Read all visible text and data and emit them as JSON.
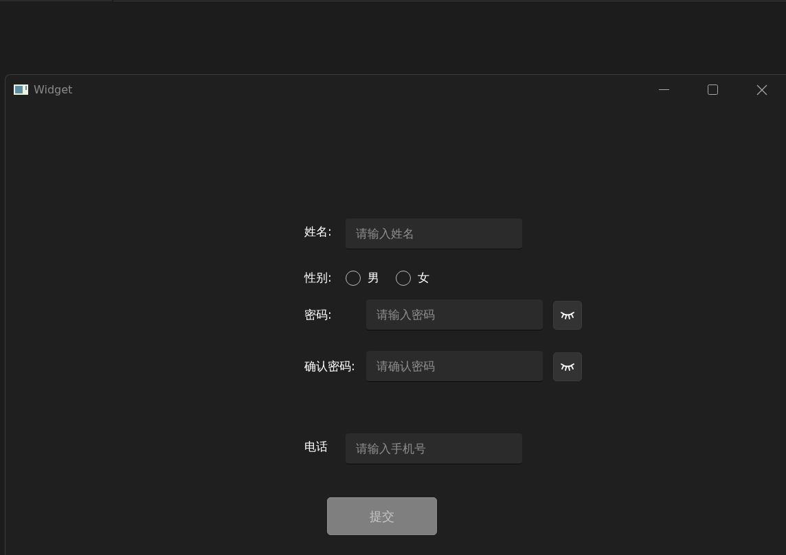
{
  "window": {
    "title": "Widget"
  },
  "form": {
    "rows": [
      {
        "kind": "text",
        "label": "姓名:",
        "placeholder": "请输入姓名"
      },
      {
        "kind": "radio",
        "label": "性别:",
        "options": [
          {
            "label": "男",
            "selected": false
          },
          {
            "label": "女",
            "selected": false
          }
        ]
      },
      {
        "kind": "password",
        "label": "密码:",
        "placeholder": "请输入密码"
      },
      {
        "kind": "password",
        "label": "确认密码:",
        "placeholder": "请确认密码"
      },
      {
        "kind": "text",
        "label": "电话",
        "placeholder": "请输入手机号"
      }
    ],
    "submit": {
      "label": "提交",
      "disabled": true
    }
  }
}
